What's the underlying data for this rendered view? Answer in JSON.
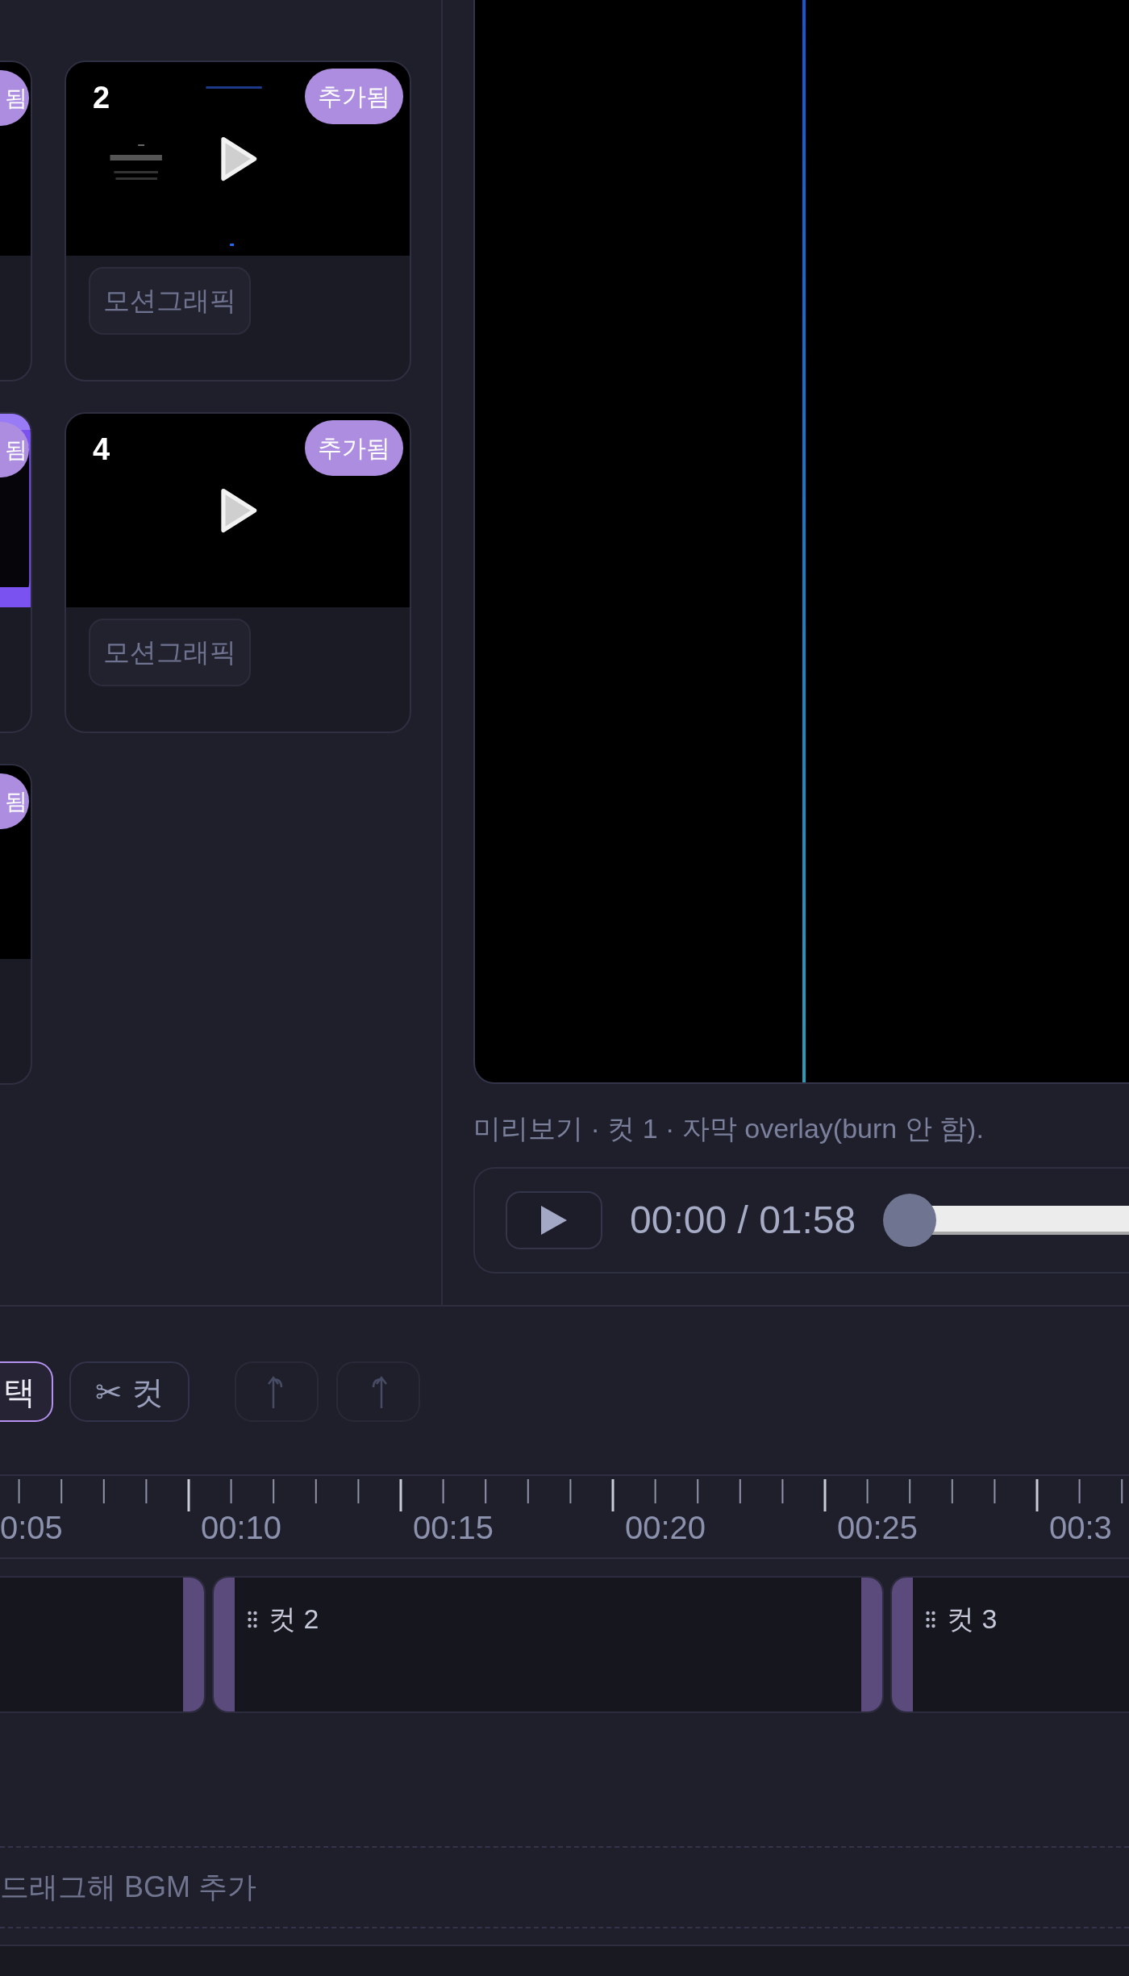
{
  "clip_library": {
    "cut_cards": [
      {
        "badge": "됨",
        "kind": "dark"
      },
      {
        "badge": "됨",
        "kind": "glow"
      },
      {
        "badge": "됨",
        "kind": "dark"
      }
    ],
    "cards": [
      {
        "number": "2",
        "badge": "추가됨",
        "tag": "모션그래픽",
        "kind": "titles"
      },
      {
        "number": "4",
        "badge": "추가됨",
        "tag": "모션그래픽",
        "kind": "dark"
      }
    ]
  },
  "preview": {
    "caption": "미리보기 · 컷 1 · 자막 overlay(burn 안 함).",
    "time": "00:00 / 01:58",
    "level": 0
  },
  "timeline": {
    "tools": [
      {
        "label": "택",
        "selected": true
      },
      {
        "label": "✂ 컷",
        "selected": false
      }
    ],
    "history": [
      {
        "kind": "undo",
        "disabled": true
      },
      {
        "kind": "redo",
        "disabled": true
      }
    ],
    "ruler_labels": [
      "0:05",
      "00:10",
      "00:15",
      "00:20",
      "00:25",
      "00:3"
    ],
    "clips": [
      {
        "selected": false
      },
      {
        "label": "컷 2",
        "selected": false
      },
      {
        "label": "컷 3",
        "selected": false
      }
    ],
    "bgm_hint": "드래그해 BGM 추가"
  }
}
